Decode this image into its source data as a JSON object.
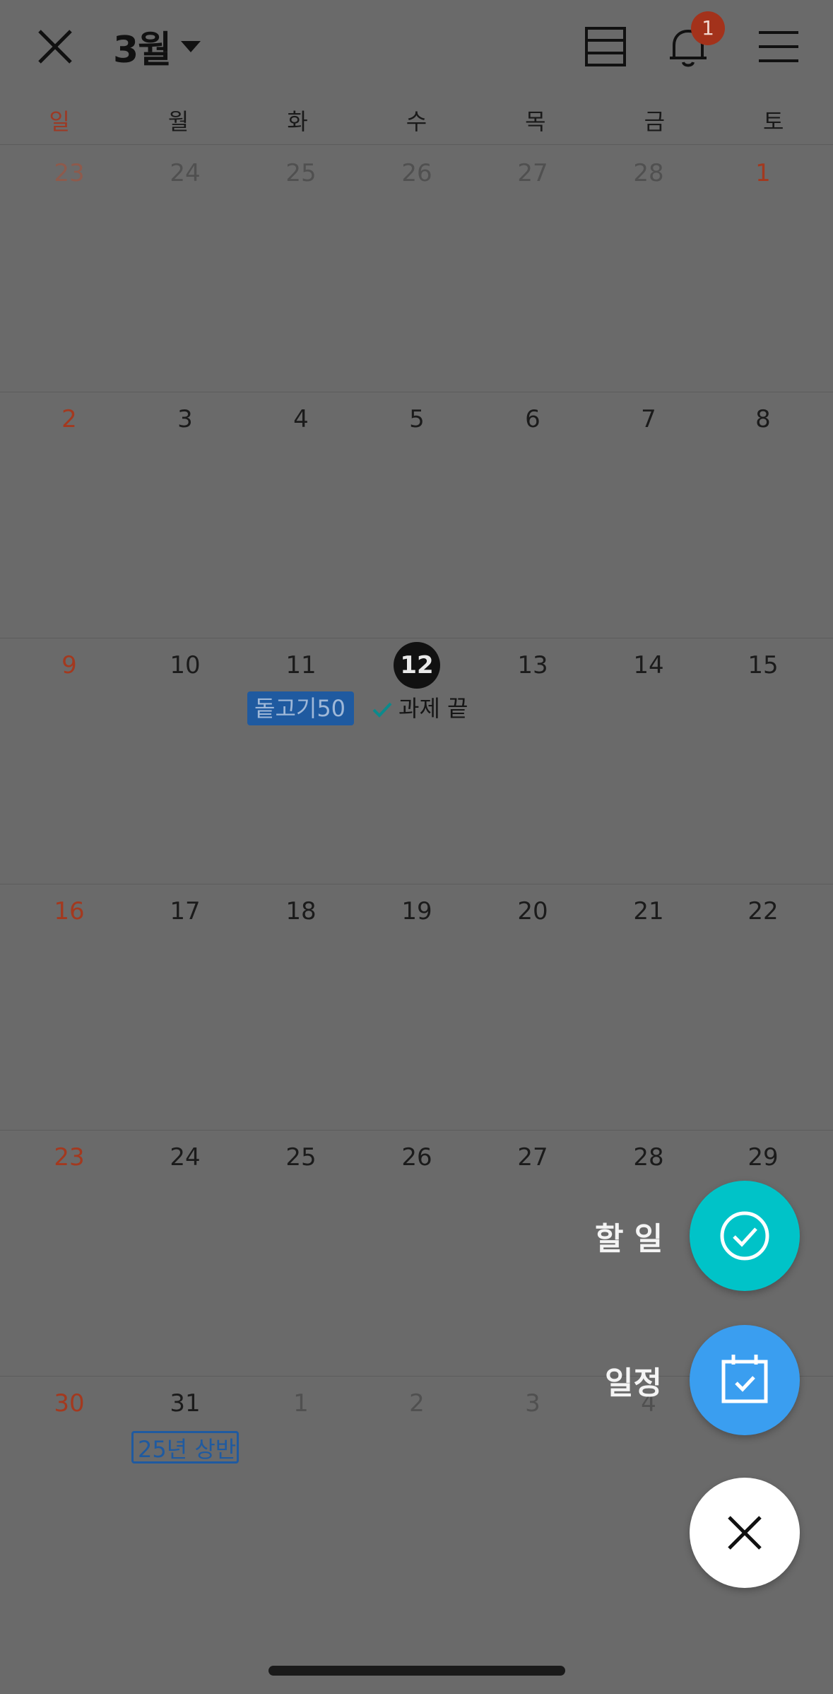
{
  "header": {
    "month_label": "3월",
    "notification_count": "1"
  },
  "weekdays": [
    "일",
    "월",
    "화",
    "수",
    "목",
    "금",
    "토"
  ],
  "weeks": [
    [
      "23",
      "24",
      "25",
      "26",
      "27",
      "28",
      "1"
    ],
    [
      "2",
      "3",
      "4",
      "5",
      "6",
      "7",
      "8"
    ],
    [
      "9",
      "10",
      "11",
      "12",
      "13",
      "14",
      "15"
    ],
    [
      "16",
      "17",
      "18",
      "19",
      "20",
      "21",
      "22"
    ],
    [
      "23",
      "24",
      "25",
      "26",
      "27",
      "28",
      "29"
    ],
    [
      "30",
      "31",
      "1",
      "2",
      "3",
      "4",
      ""
    ]
  ],
  "events": {
    "event_11": "돝고기50",
    "todo_12": "과제 끝",
    "event_31": "25년 상반"
  },
  "fab": {
    "todo_label": "할 일",
    "schedule_label": "일정"
  },
  "colors": {
    "overlay_bg": "#6a6a6a",
    "sunday_red": "#a3391f",
    "todo_teal": "#00c3c8",
    "schedule_blue": "#3a9ef0",
    "event_blue": "#1f5aa0"
  }
}
